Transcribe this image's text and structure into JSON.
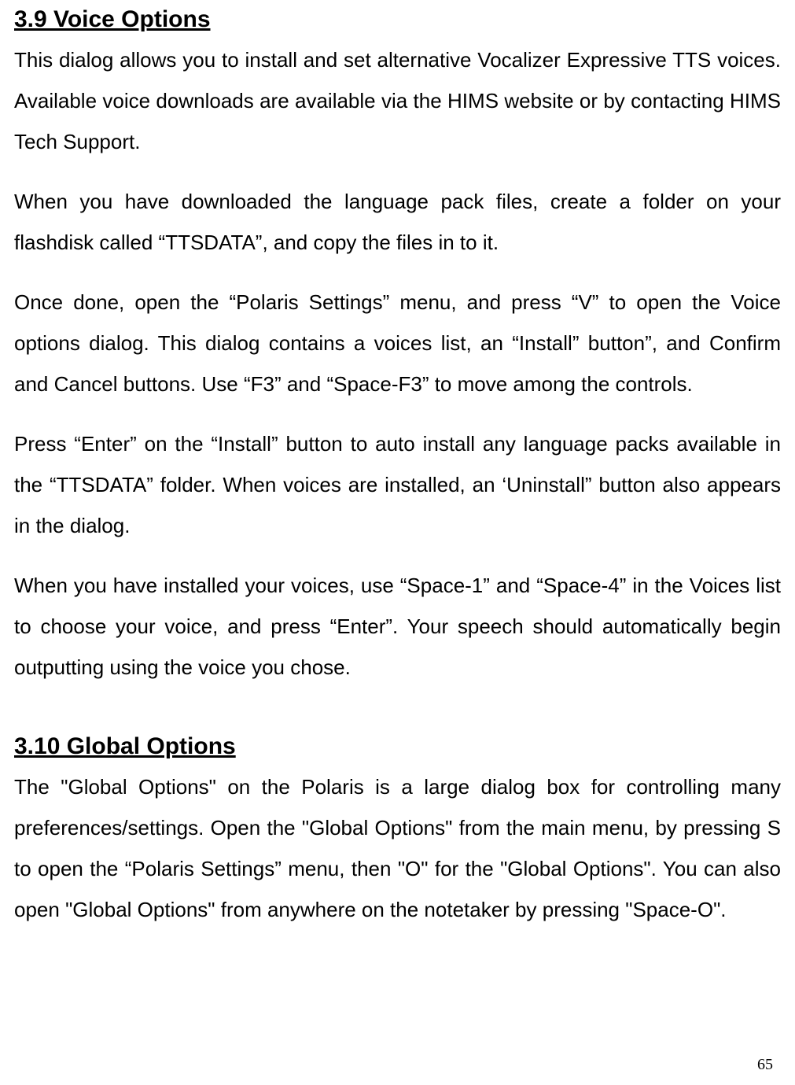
{
  "section1": {
    "heading": "3.9 Voice Options",
    "p1": "This dialog allows you to install and set alternative Vocalizer Expressive TTS voices. Available voice downloads are available via the HIMS website or by contacting HIMS Tech Support.",
    "p2": "When you have downloaded the language pack files, create a folder on your flashdisk called “TTSDATA”, and copy the files in to it.",
    "p3": "Once done, open the “Polaris Settings” menu, and press “V” to open the Voice options dialog. This dialog contains a voices list, an “Install” button”, and Confirm and Cancel buttons. Use “F3” and “Space-F3” to move among the controls.",
    "p4": "Press “Enter” on the “Install” button to auto install any language packs available in the “TTSDATA” folder. When voices are installed, an ‘Uninstall” button also appears in the dialog.",
    "p5": "When you have installed your voices, use “Space-1” and “Space-4” in the Voices list to choose your voice, and press “Enter”. Your speech should automatically begin outputting using the voice you chose."
  },
  "section2": {
    "heading": "3.10 Global Options",
    "p1": "The \"Global Options\" on the Polaris is a large dialog box for controlling many preferences/settings.  Open the \"Global Options\" from the main menu, by pressing S to open the “Polaris Settings” menu, then \"O\" for the \"Global Options\". You can also open \"Global Options\" from anywhere on the notetaker by pressing \"Space-O\"."
  },
  "pageNumber": "65"
}
